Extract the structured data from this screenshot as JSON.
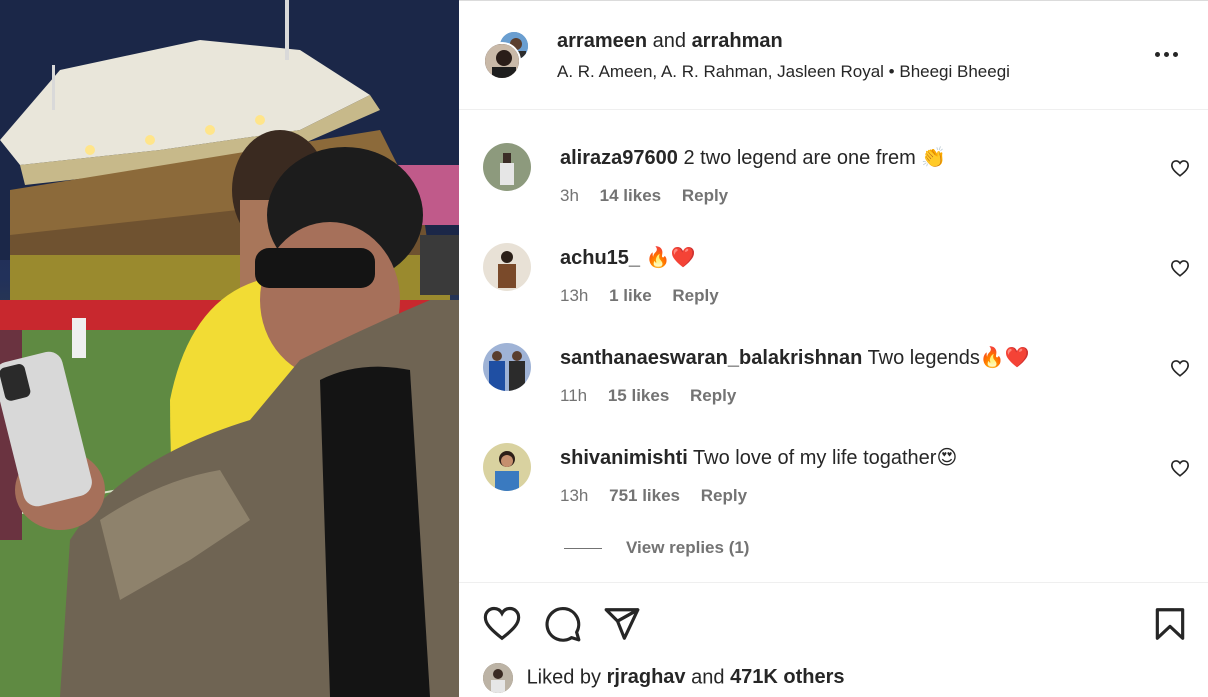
{
  "post": {
    "owners": {
      "user1": "arrameen",
      "joiner": "and",
      "user2": "arrahman"
    },
    "audio": {
      "artists": "A. R. Ameen, A. R. Rahman, Jasleen Royal",
      "separator": "•",
      "song": "Bheegi Bheegi"
    }
  },
  "comments": [
    {
      "username": "aliraza97600",
      "text": "2 two legend are one frem",
      "emoji": "👏",
      "time": "3h",
      "likes": "14 likes",
      "reply": "Reply"
    },
    {
      "username": "achu15_",
      "text": "",
      "emoji": "🔥❤️",
      "time": "13h",
      "likes": "1 like",
      "reply": "Reply"
    },
    {
      "username": "santhanaeswaran_balakrishnan",
      "text": "Two legends",
      "emoji": "🔥❤️",
      "time": "11h",
      "likes": "15 likes",
      "reply": "Reply"
    },
    {
      "username": "shivanimishti",
      "text": "Two love of my life togather",
      "emoji": "😍",
      "time": "13h",
      "likes": "751 likes",
      "reply": "Reply"
    }
  ],
  "view_replies": "View replies (1)",
  "liked_by": {
    "prefix": "Liked by",
    "user": "rjraghav",
    "joiner": "and",
    "others": "471K others"
  },
  "icons": {
    "more": "more-horizontal-icon",
    "comment_like": "heart-outline-icon",
    "like": "heart-outline-icon",
    "comment": "speech-bubble-icon",
    "share": "paper-plane-icon",
    "save": "bookmark-icon"
  },
  "colors": {
    "text": "#262626",
    "secondary": "#737373",
    "divider": "#efefef"
  }
}
